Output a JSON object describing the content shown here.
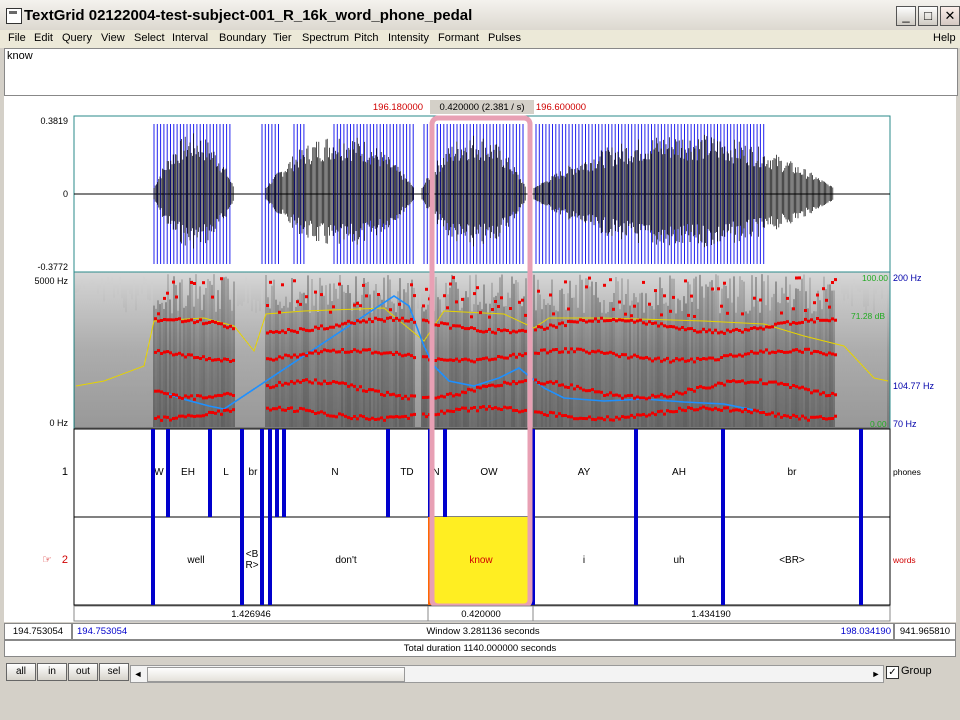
{
  "window": {
    "title": "TextGrid 02122004-test-subject-001_R_16k_word_phone_pedal",
    "min_label": "_",
    "max_label": "□",
    "close_label": "✕"
  },
  "menu": [
    "File",
    "Edit",
    "Query",
    "View",
    "Select",
    "Interval",
    "Boundary",
    "Tier",
    "Spectrum",
    "Pitch",
    "Intensity",
    "Formant",
    "Pulses"
  ],
  "help_label": "Help",
  "text_field": "know",
  "selection": {
    "start": "196.180000",
    "duration": "0.420000 (2.381 / s)",
    "end": "196.600000"
  },
  "waveform": {
    "ymax": "0.3819",
    "yzero": "0",
    "ymin": "-0.3772"
  },
  "spectrogram": {
    "freq_top": "5000 Hz",
    "freq_bottom": "0 Hz",
    "pitch_top": "200 Hz",
    "pitch_mid": "104.77 Hz",
    "pitch_bottom": "70 Hz",
    "intensity_top": "100.00",
    "intensity_mid": "71.28 dB",
    "intensity_bottom": "0.00"
  },
  "tiers": [
    {
      "number": "1",
      "name": "phones",
      "labels": [
        "W",
        "EH",
        "L",
        "br",
        "N",
        "TD",
        "N",
        "OW",
        "AY",
        "AH",
        "br"
      ]
    },
    {
      "number": "2",
      "name": "words",
      "marker": "☞",
      "labels": [
        "well",
        "<B R>",
        "don't",
        "know",
        "i",
        "uh",
        "<BR>"
      ]
    }
  ],
  "durations": {
    "left": "1.426946",
    "selected": "0.420000",
    "right": "1.434190"
  },
  "window_bar": {
    "total_start": "194.753054",
    "visible_start": "194.753054",
    "window": "Window 3.281136 seconds",
    "visible_end": "198.034190",
    "total_end": "941.965810"
  },
  "total_duration": "Total duration 1140.000000 seconds",
  "buttons": {
    "all": "all",
    "in": "in",
    "out": "out",
    "sel": "sel"
  },
  "scroll": {
    "left_arrow": "◄",
    "right_arrow": "►"
  },
  "group": {
    "label": "Group",
    "checked": true,
    "check_mark": "✓"
  },
  "colors": {
    "selection": "#e8a0b4",
    "boundary": "#0000cc",
    "formant": "#ee0000",
    "pitch": "#1e90ff",
    "highlight": "#ffee22"
  }
}
